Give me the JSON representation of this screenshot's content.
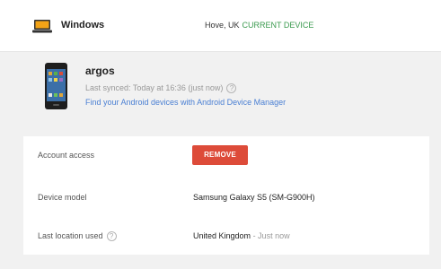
{
  "computer": {
    "name": "Windows",
    "location": "Hove, UK",
    "current_label": "CURRENT DEVICE",
    "icon": "laptop-icon"
  },
  "phone": {
    "name": "argos",
    "synced": "Last synced: Today at 16:36 (just now)",
    "help_glyph": "?",
    "adm_link": "Find your Android devices with Android Device Manager",
    "icon": "phone-icon"
  },
  "details": {
    "account_access_label": "Account access",
    "remove_label": "REMOVE",
    "device_model_label": "Device model",
    "device_model_value": "Samsung Galaxy S5 (SM-G900H)",
    "last_location_label": "Last location used",
    "last_location_value": "United Kingdom",
    "last_location_time": "- Just now"
  },
  "colors": {
    "accent_green": "#3a9a4e",
    "link_blue": "#4a7fd3",
    "remove_red": "#dd4b39"
  }
}
